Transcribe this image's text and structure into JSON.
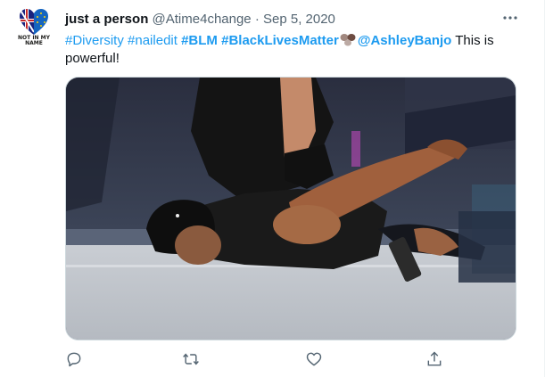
{
  "tweet": {
    "avatar": {
      "text_line1": "NOT IN MY",
      "text_line2": "NAME"
    },
    "author_name": "just a person",
    "author_handle": "@Atime4change",
    "separator": "·",
    "date": "Sep 5, 2020",
    "text": {
      "hashtag_1": "#Diversity",
      "hashtag_2": "#nailedit",
      "hashtag_3": "#BLM",
      "hashtag_4": "#BlackLivesMatter",
      "emoji": "emoji-fist-bump",
      "mention": "@AshleyBanjo",
      "after_mention": "This is",
      "line_2": "powerful!"
    },
    "media": {
      "icon": "photo-dancer-on-floor"
    },
    "actions": {
      "reply_icon": "speech-bubble-icon",
      "retweet_icon": "retweet-icon",
      "like_icon": "heart-icon",
      "share_icon": "share-icon"
    }
  },
  "colors": {
    "link": "#1d9bf0",
    "secondary_text": "#536471",
    "border": "#cfd9de"
  }
}
